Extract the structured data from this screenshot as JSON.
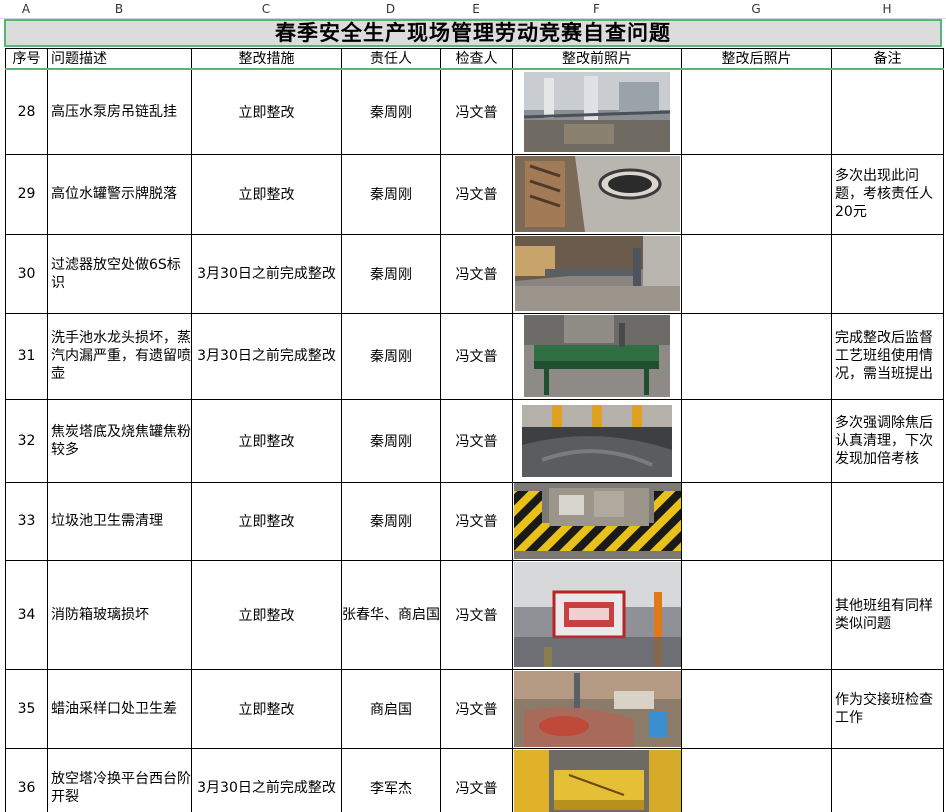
{
  "column_letters": [
    "A",
    "B",
    "C",
    "D",
    "E",
    "F",
    "G",
    "H"
  ],
  "title": "春季安全生产现场管理劳动竞赛自查问题",
  "headers": [
    "序号",
    "问题描述",
    "整改措施",
    "责任人",
    "检查人",
    "整改前照片",
    "整改后照片",
    "备注"
  ],
  "rows": [
    {
      "no": "28",
      "desc": "高压水泵房吊链乱挂",
      "measure": "立即整改",
      "owner": "秦周刚",
      "checker": "冯文普",
      "before_photo": "pump-room-photo",
      "after_photo": "",
      "note": ""
    },
    {
      "no": "29",
      "desc": "高位水罐警示牌脱落",
      "measure": "立即整改",
      "owner": "秦周刚",
      "checker": "冯文普",
      "before_photo": "water-tank-photo",
      "after_photo": "",
      "note": "多次出现此问题，考核责任人20元"
    },
    {
      "no": "30",
      "desc": "过滤器放空处做6S标识",
      "measure": "3月30日之前完成整改",
      "owner": "秦周刚",
      "checker": "冯文普",
      "before_photo": "filter-vent-photo",
      "after_photo": "",
      "note": ""
    },
    {
      "no": "31",
      "desc": "洗手池水龙头损坏，蒸汽内漏严重，有遗留喷壶",
      "measure": "3月30日之前完成整改",
      "owner": "秦周刚",
      "checker": "冯文普",
      "before_photo": "wash-basin-photo",
      "after_photo": "",
      "note": "完成整改后监督工艺班组使用情况，需当班提出"
    },
    {
      "no": "32",
      "desc": "焦炭塔底及烧焦罐焦粉较多",
      "measure": "立即整改",
      "owner": "秦周刚",
      "checker": "冯文普",
      "before_photo": "coke-tower-photo",
      "after_photo": "",
      "note": "多次强调除焦后认真清理，下次发现加倍考核"
    },
    {
      "no": "33",
      "desc": "垃圾池卫生需清理",
      "measure": "立即整改",
      "owner": "秦周刚",
      "checker": "冯文普",
      "before_photo": "garbage-pit-photo",
      "after_photo": "",
      "note": ""
    },
    {
      "no": "34",
      "desc": "消防箱玻璃损坏",
      "measure": "立即整改",
      "owner": "张春华、商启国",
      "checker": "冯文普",
      "before_photo": "fire-box-photo",
      "after_photo": "",
      "note": "其他班组有同样类似问题"
    },
    {
      "no": "35",
      "desc": "蜡油采样口处卫生差",
      "measure": "立即整改",
      "owner": "商启国",
      "checker": "冯文普",
      "before_photo": "sampling-port-photo",
      "after_photo": "",
      "note": "作为交接班检查工作"
    },
    {
      "no": "36",
      "desc": "放空塔冷换平台西台阶开裂",
      "measure": "3月30日之前完成整改",
      "owner": "李军杰",
      "checker": "冯文普",
      "before_photo": "platform-steps-photo",
      "after_photo": "",
      "note": ""
    }
  ],
  "colors": {
    "title_bg": "#dcdcdc",
    "selection_border": "#5bb37a",
    "grid_line": "#000000"
  }
}
